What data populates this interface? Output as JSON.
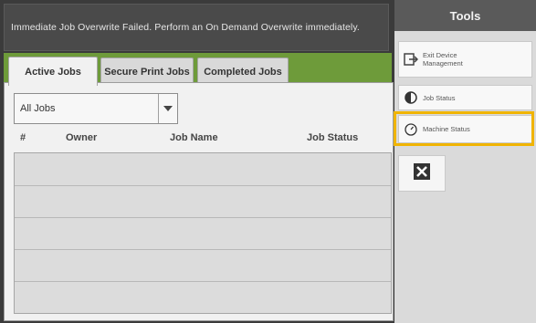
{
  "banner": {
    "message": "Immediate Job Overwrite Failed.  Perform an On Demand Overwrite immediately."
  },
  "tabs": [
    {
      "label": "Active Jobs",
      "active": true
    },
    {
      "label": "Secure Print Jobs",
      "active": false
    },
    {
      "label": "Completed Jobs",
      "active": false
    }
  ],
  "filter": {
    "selected": "All Jobs"
  },
  "table": {
    "columns": [
      "#",
      "Owner",
      "Job Name",
      "Job Status"
    ]
  },
  "tools": {
    "title": "Tools",
    "items": [
      {
        "label": "Exit Device Management",
        "icon": "exit-icon"
      },
      {
        "label": "Job Status",
        "icon": "job-status-icon"
      },
      {
        "label": "Machine Status",
        "icon": "machine-status-icon"
      }
    ],
    "close_icon": "close-icon"
  },
  "colors": {
    "accent_green": "#6e9b3a",
    "highlight": "#f0b400"
  }
}
